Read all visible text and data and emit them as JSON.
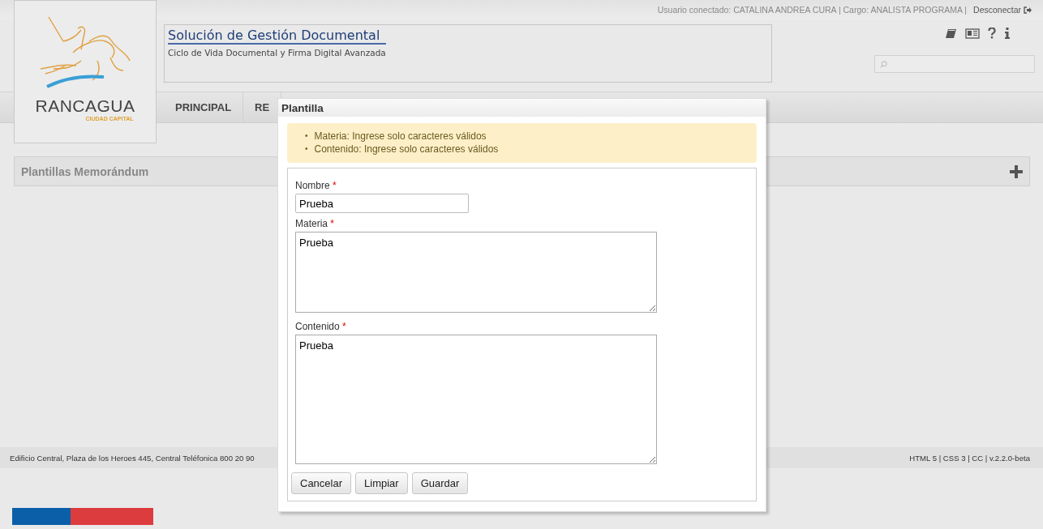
{
  "top_bar": {
    "user_info": "Usuario conectado: CATALINA ANDREA CURA | Cargo: ANALISTA PROGRAMA |",
    "logout": "Desconectar"
  },
  "logo": {
    "name": "RANCAGUA",
    "tagline": "CIUDAD CAPITAL"
  },
  "header": {
    "title": "Solución de Gestión Documental",
    "subtitle": "Ciclo de Vida Documental y Firma Digital Avanzada"
  },
  "nav": {
    "items": [
      {
        "label": "PRINCIPAL"
      },
      {
        "label": "RE"
      }
    ]
  },
  "panel": {
    "title": "Plantillas Memorándum"
  },
  "footer": {
    "address": "Edificio Central, Plaza de los Heroes 445, Central Teléfonica 800 20 90",
    "version": "HTML 5 | CSS 3 | CC | v.2.2.0-beta"
  },
  "dialog": {
    "title": "Plantilla",
    "errors": [
      {
        "bullet": "•",
        "text": "Materia: Ingrese solo caracteres válidos"
      },
      {
        "bullet": "•",
        "text": "Contenido: Ingrese solo caracteres válidos"
      }
    ],
    "fields": [
      {
        "kind": "input",
        "label": "Nombre",
        "required_mark": "*",
        "value": "Prueba"
      },
      {
        "kind": "textarea",
        "label": "Materia",
        "required_mark": "*",
        "value": "Prueba"
      },
      {
        "kind": "textarea",
        "label": "Contenido",
        "required_mark": "*",
        "value": "Prueba"
      }
    ],
    "buttons": [
      "Cancelar",
      "Limpiar",
      "Guardar"
    ]
  }
}
